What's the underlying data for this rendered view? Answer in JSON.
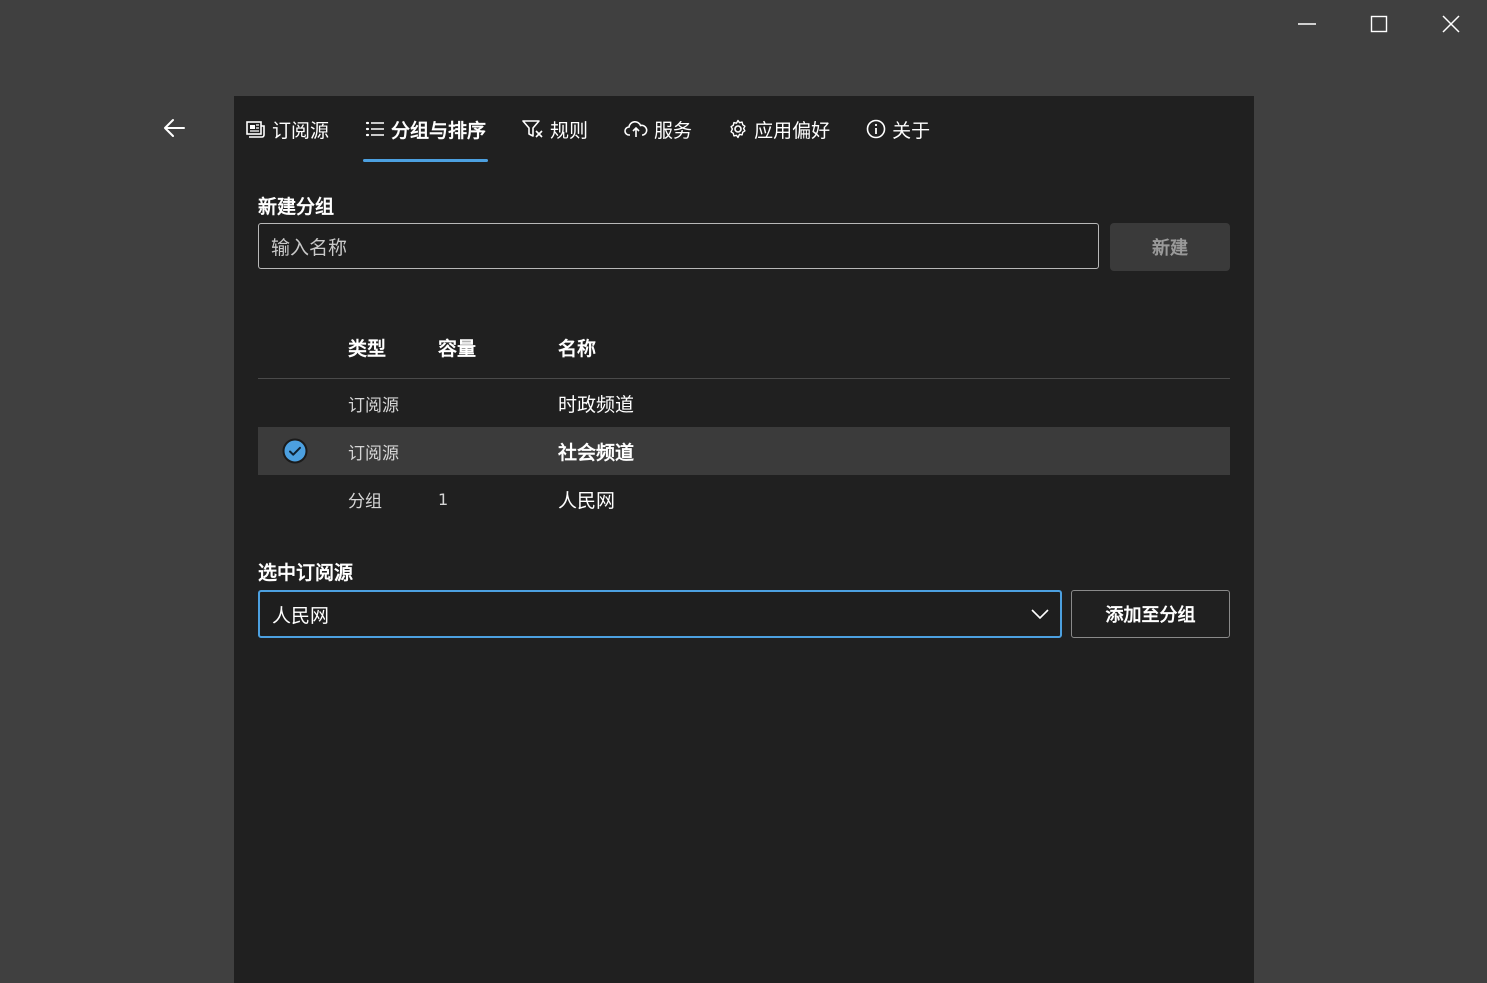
{
  "window": {
    "controls": {
      "minimize": "minimize-icon",
      "maximize": "maximize-icon",
      "close": "close-icon"
    }
  },
  "nav": {
    "back_icon": "arrow-left-icon",
    "tabs": [
      {
        "label": "订阅源",
        "icon": "feed-icon",
        "active": false
      },
      {
        "label": "分组与排序",
        "icon": "list-icon",
        "active": true
      },
      {
        "label": "规则",
        "icon": "filter-icon",
        "active": false
      },
      {
        "label": "服务",
        "icon": "cloud-sync-icon",
        "active": false
      },
      {
        "label": "应用偏好",
        "icon": "gear-icon",
        "active": false
      },
      {
        "label": "关于",
        "icon": "info-icon",
        "active": false
      }
    ],
    "accent_color": "#4ca0e0"
  },
  "new_group": {
    "title": "新建分组",
    "input_placeholder": "输入名称",
    "button_label": "新建"
  },
  "groups_table": {
    "headers": {
      "type": "类型",
      "capacity": "容量",
      "name": "名称"
    },
    "rows": [
      {
        "type": "订阅源",
        "capacity": "",
        "name": "时政频道",
        "selected": false
      },
      {
        "type": "订阅源",
        "capacity": "",
        "name": "社会频道",
        "selected": true
      },
      {
        "type": "分组",
        "capacity": "1",
        "name": "人民网",
        "selected": false
      }
    ]
  },
  "selected_feed": {
    "title": "选中订阅源",
    "value": "人民网",
    "button_label": "添加至分组"
  }
}
